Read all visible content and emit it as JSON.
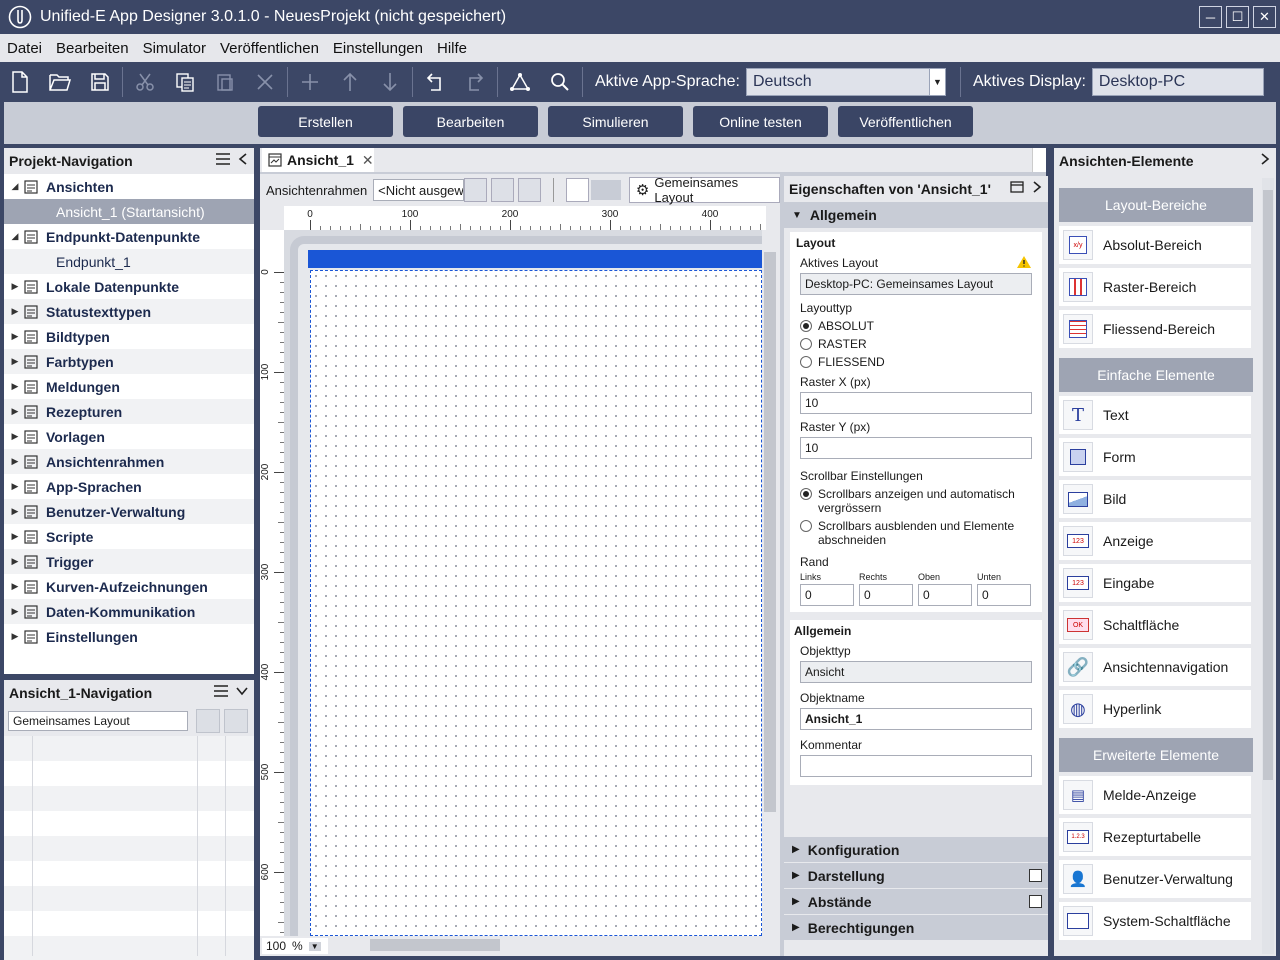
{
  "window": {
    "title": "Unified-E App Designer 3.0.1.0 - NeuesProjekt  (nicht gespeichert)",
    "controls": [
      "─",
      "☐",
      "✕"
    ]
  },
  "menu": [
    "Datei",
    "Bearbeiten",
    "Simulator",
    "Veröffentlichen",
    "Einstellungen",
    "Hilfe"
  ],
  "toolbar": {
    "language_label": "Aktive App-Sprache:",
    "language_value": "Deutsch",
    "display_label": "Aktives Display:",
    "display_value": "Desktop-PC",
    "icons": [
      "new-file-icon",
      "open-folder-icon",
      "save-icon",
      "cut-icon",
      "copy-icon",
      "paste-icon",
      "delete-icon",
      "add-icon",
      "move-up-icon",
      "move-down-icon",
      "undo-icon",
      "redo-icon",
      "tree-icon",
      "search-icon"
    ]
  },
  "actions": [
    "Erstellen",
    "Bearbeiten",
    "Simulieren",
    "Online testen",
    "Veröffentlichen"
  ],
  "project_nav": {
    "title": "Projekt-Navigation",
    "items": [
      {
        "label": "Ansichten",
        "expanded": true,
        "icon": "views-icon"
      },
      {
        "label": "Ansicht_1 (Startansicht)",
        "child": true,
        "selected": true
      },
      {
        "label": "Endpunkt-Datenpunkte",
        "expanded": true,
        "icon": "endpoint-icon"
      },
      {
        "label": "Endpunkt_1",
        "child": true
      },
      {
        "label": "Lokale Datenpunkte",
        "icon": "local-data-icon"
      },
      {
        "label": "Statustexttypen",
        "icon": "status-text-icon"
      },
      {
        "label": "Bildtypen",
        "icon": "image-type-icon"
      },
      {
        "label": "Farbtypen",
        "icon": "color-type-icon"
      },
      {
        "label": "Meldungen",
        "icon": "alarm-icon"
      },
      {
        "label": "Rezepturen",
        "icon": "recipe-icon"
      },
      {
        "label": "Vorlagen",
        "icon": "template-icon"
      },
      {
        "label": "Ansichtenrahmen",
        "icon": "frame-icon"
      },
      {
        "label": "App-Sprachen",
        "icon": "language-icon"
      },
      {
        "label": "Benutzer-Verwaltung",
        "icon": "user-icon"
      },
      {
        "label": "Scripte",
        "icon": "script-icon"
      },
      {
        "label": "Trigger",
        "icon": "trigger-icon"
      },
      {
        "label": "Kurven-Aufzeichnungen",
        "icon": "chart-icon"
      },
      {
        "label": "Daten-Kommunikation",
        "icon": "communication-icon"
      },
      {
        "label": "Einstellungen",
        "icon": "settings-icon"
      }
    ]
  },
  "view_nav": {
    "title": "Ansicht_1-Navigation",
    "layout_value": "Gemeinsames Layout"
  },
  "editor": {
    "tab_label": "Ansicht_1",
    "frame_label": "Ansichtenrahmen",
    "frame_value": "<Nicht ausgewäh",
    "layout_button": "Gemeinsames Layout",
    "ruler_x": [
      "0",
      "100",
      "200",
      "300",
      "400"
    ],
    "ruler_y": [
      "0",
      "100",
      "200",
      "300",
      "400",
      "500",
      "600"
    ],
    "zoom": "100",
    "zoom_unit": "%"
  },
  "properties": {
    "title": "Eigenschaften von 'Ansicht_1'",
    "section_general": "Allgemein",
    "layout_group": "Layout",
    "active_layout_label": "Aktives Layout",
    "active_layout_value": "Desktop-PC: Gemeinsames Layout",
    "layout_type_label": "Layouttyp",
    "layout_types": [
      "ABSOLUT",
      "RASTER",
      "FLIESSEND"
    ],
    "raster_x_label": "Raster X (px)",
    "raster_x_value": "10",
    "raster_y_label": "Raster Y (px)",
    "raster_y_value": "10",
    "scrollbar_label": "Scrollbar Einstellungen",
    "scroll_options": [
      "Scrollbars anzeigen und automatisch vergrössern",
      "Scrollbars ausblenden und Elemente abschneiden"
    ],
    "margin_label": "Rand",
    "margin_fields": [
      {
        "label": "Links",
        "value": "0"
      },
      {
        "label": "Rechts",
        "value": "0"
      },
      {
        "label": "Oben",
        "value": "0"
      },
      {
        "label": "Unten",
        "value": "0"
      }
    ],
    "general_group": "Allgemein",
    "object_type_label": "Objekttyp",
    "object_type_value": "Ansicht",
    "object_name_label": "Objektname",
    "object_name_value": "Ansicht_1",
    "comment_label": "Kommentar",
    "comment_value": "",
    "sections": [
      "Konfiguration",
      "Darstellung",
      "Abstände",
      "Berechtigungen"
    ]
  },
  "elements_panel": {
    "title": "Ansichten-Elemente",
    "groups": [
      {
        "title": "Layout-Bereiche",
        "items": [
          "Absolut-Bereich",
          "Raster-Bereich",
          "Fliessend-Bereich"
        ]
      },
      {
        "title": "Einfache Elemente",
        "items": [
          "Text",
          "Form",
          "Bild",
          "Anzeige",
          "Eingabe",
          "Schaltfläche",
          "Ansichtennavigation",
          "Hyperlink"
        ]
      },
      {
        "title": "Erweiterte Elemente",
        "items": [
          "Melde-Anzeige",
          "Rezepturtabelle",
          "Benutzer-Verwaltung",
          "System-Schaltfläche"
        ]
      }
    ],
    "icon_texts": {
      "absolut": "x/y",
      "anzeige": "123",
      "eingabe": "123",
      "schaltflaeche": "OK",
      "rezeptur": "1.2.3"
    }
  },
  "colors": {
    "chrome": "#3c4766",
    "panel": "#e8e9ed",
    "selected": "#9ea4b3",
    "canvas_header": "#1a56d6",
    "warning": "#f5c400"
  }
}
